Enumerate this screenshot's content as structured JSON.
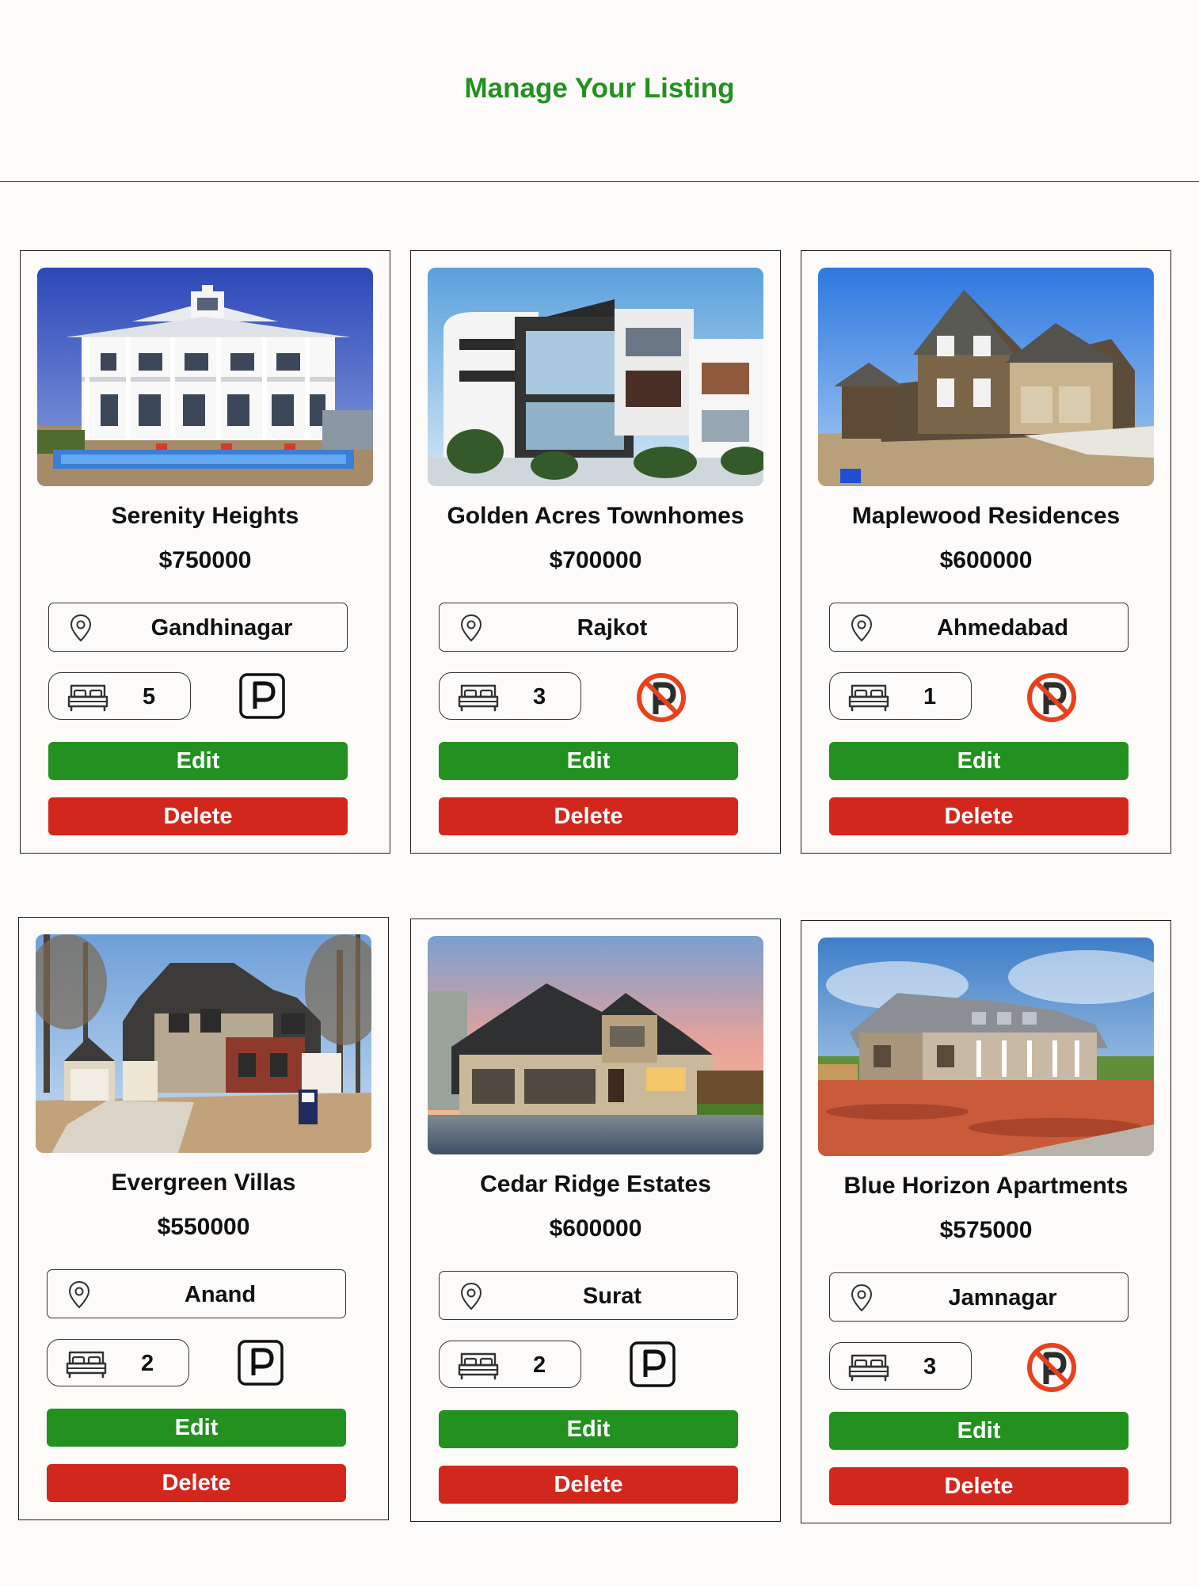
{
  "header": {
    "title": "Manage Your Listing"
  },
  "listings": [
    {
      "name": "Serenity Heights",
      "price": "$750000",
      "location": "Gandhinagar",
      "bedrooms": "5",
      "parking": true,
      "edit_label": "Edit",
      "delete_label": "Delete"
    },
    {
      "name": "Golden Acres Townhomes",
      "price": "$700000",
      "location": "Rajkot",
      "bedrooms": "3",
      "parking": false,
      "edit_label": "Edit",
      "delete_label": "Delete"
    },
    {
      "name": "Maplewood Residences",
      "price": "$600000",
      "location": "Ahmedabad",
      "bedrooms": "1",
      "parking": false,
      "edit_label": "Edit",
      "delete_label": "Delete"
    },
    {
      "name": "Evergreen Villas",
      "price": "$550000",
      "location": "Anand",
      "bedrooms": "2",
      "parking": true,
      "edit_label": "Edit",
      "delete_label": "Delete"
    },
    {
      "name": "Cedar Ridge Estates",
      "price": "$600000",
      "location": "Surat",
      "bedrooms": "2",
      "parking": true,
      "edit_label": "Edit",
      "delete_label": "Delete"
    },
    {
      "name": "Blue Horizon Apartments",
      "price": "$575000",
      "location": "Jamnagar",
      "bedrooms": "3",
      "parking": false,
      "edit_label": "Edit",
      "delete_label": "Delete"
    }
  ],
  "icons": {
    "location": "map-pin-icon",
    "bedrooms": "bed-icon",
    "parking_available": "parking-icon",
    "parking_unavailable": "no-parking-icon"
  },
  "colors": {
    "title": "#22911f",
    "edit_button": "#22911f",
    "delete_button": "#d2271d",
    "no_parking": "#e8411c"
  }
}
